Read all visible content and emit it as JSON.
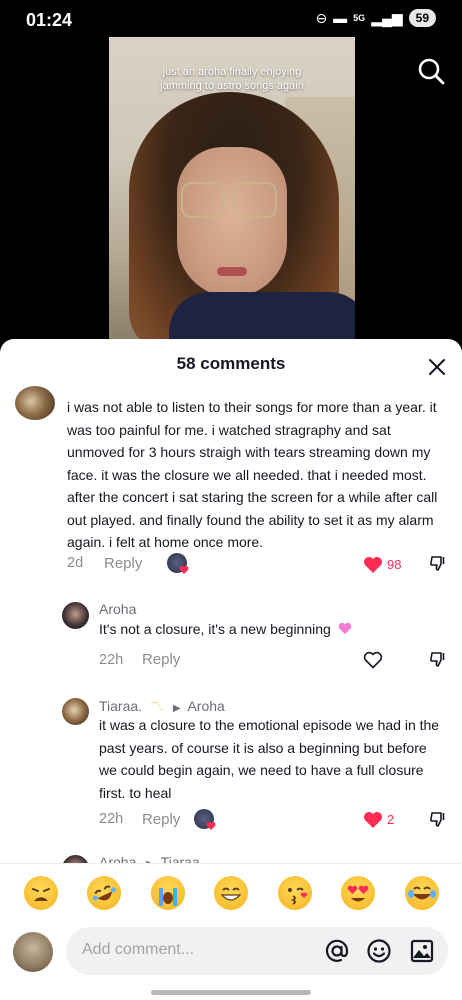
{
  "status_bar": {
    "time": "01:24",
    "battery": "59",
    "network": "5G"
  },
  "video": {
    "caption_line1": "just an aroha finally enjoying",
    "caption_line2": "jamming to astro songs again"
  },
  "comments_header": {
    "title": "58 comments"
  },
  "comments": [
    {
      "text_lines": [
        "i was not able to listen to their songs for more than a year. it",
        "was too painful for me. i watched stragraphy and sat",
        "unmoved for 3 hours straigh with tears streaming down my",
        "face. it was the closure we all needed. that i needed most.",
        "after the concert i sat staring the screen for a while after call",
        "out played. and finally found the ability to set it as my alarm",
        "again. i felt at home once more."
      ],
      "time": "2d",
      "reply_label": "Reply",
      "likes": "98",
      "liked": true
    },
    {
      "username": "Aroha",
      "text": "It's not a closure, it's a new beginning",
      "time": "22h",
      "reply_label": "Reply"
    },
    {
      "username": "Tiaraa.",
      "reply_to": "Aroha",
      "text_lines": [
        "it was a closure to the emotional episode we had in the",
        "past years. of course it is also a beginning but before",
        "we could begin again, we need to have a full closure",
        "first. to heal"
      ],
      "time": "22h",
      "reply_label": "Reply",
      "likes": "2",
      "liked": true
    },
    {
      "username": "Aroha",
      "reply_to": "Tiaraa."
    }
  ],
  "emoji_bar": [
    "weary-face",
    "rofl-face",
    "crying-face",
    "grinning-face",
    "kiss-wink-face",
    "heart-eyes-face",
    "tears-of-joy-face"
  ],
  "input": {
    "placeholder": "Add comment..."
  },
  "colors": {
    "like_red": "#fe2c55",
    "muted": "#8a8b91"
  }
}
